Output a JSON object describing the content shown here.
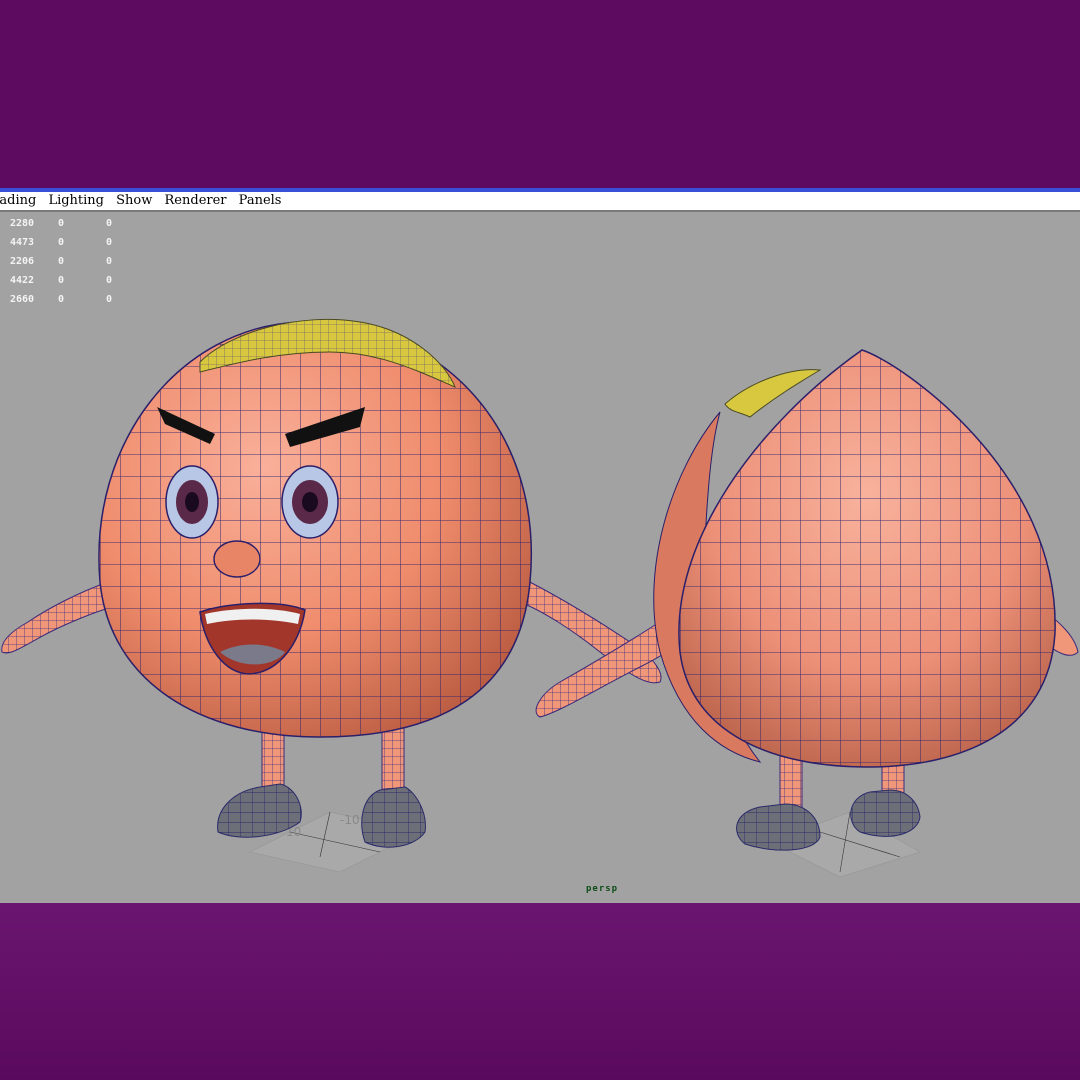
{
  "menu": {
    "items": [
      "hading",
      "Lighting",
      "Show",
      "Renderer",
      "Panels"
    ]
  },
  "hud": {
    "rows": [
      [
        "2280",
        "0",
        "0"
      ],
      [
        "4473",
        "0",
        "0"
      ],
      [
        "2206",
        "0",
        "0"
      ],
      [
        "4422",
        "0",
        "0"
      ],
      [
        "2660",
        "0",
        "0"
      ]
    ]
  },
  "viewport": {
    "camera_label": "persp",
    "grid_labels": [
      "10",
      "-10",
      "10"
    ],
    "background_color": "#a2a2a2"
  },
  "colors": {
    "frame": "#5c0b61",
    "accent": "#3a4fd8",
    "mesh_skin": "#f09070",
    "wire": "#2a1f6a",
    "cap": "#d8c840",
    "shoes": "#6d6f78"
  }
}
